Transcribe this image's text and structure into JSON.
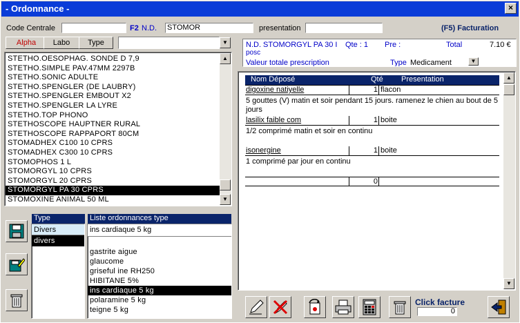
{
  "window": {
    "title": "- Ordonnance -",
    "close": "×"
  },
  "header": {
    "code_centrale_label": "Code Centrale",
    "code_centrale_value": "",
    "f2_label": "F2",
    "nd_label": "N.D.",
    "nd_value": "STOMOR",
    "presentation_label": "presentation",
    "presentation_value": "",
    "facturation_label": "(F5) Facturation"
  },
  "tabs": {
    "alpha": "Alpha",
    "labo": "Labo",
    "type": "Type"
  },
  "product_list": [
    "STETHO.OESOPHAG. SONDE D 7,9",
    "STETHO.SIMPLE PAV.47MM 2297B",
    "STETHO.SONIC ADULTE",
    "STETHO.SPENGLER (DE LAUBRY)",
    "STETHO.SPENGLER EMBOUT X2",
    "STETHO.SPENGLER LA LYRE",
    "STETHO.TOP PHONO",
    "STETHOSCOPE HAUPTNER RURAL",
    "STETHOSCOPE RAPPAPORT 80CM",
    "STOMADHEX C100 10 CPRS",
    "STOMADHEX C300 10 CPRS",
    "STOMOPHOS 1 L",
    "STOMORGYL 10 CPRS",
    "STOMORGYL 20 CPRS",
    "STOMORGYL PA 30 CPRS",
    "STOMOXINE ANIMAL 50 ML"
  ],
  "selected_product_index": 14,
  "info": {
    "nd_text": "N.D. STOMORGYL PA 30 I",
    "posc": "posc",
    "qte_label": "Qte : 1",
    "pre_label": "Pre :",
    "total_label": "Total",
    "total_value": "7.10 €",
    "valeur_label": "Valeur totale prescription",
    "type_label": "Type",
    "type_value": "Medicament"
  },
  "prescription": {
    "headers": {
      "nom": "Nom Déposé",
      "qte": "Qté",
      "presentation": "Presentation"
    },
    "rows": [
      {
        "nom": "digoxine natiyelle",
        "qte": "1",
        "presentation": "flacon",
        "posologie": "5 gouttes (V) matin et soir pendant 15 jours. ramenez le chien au bout de 5 jours"
      },
      {
        "nom": "lasilix faible com",
        "qte": "1",
        "presentation": "boite",
        "posologie": "1/2 comprimé matin et soir en continu"
      },
      {
        "nom": "isonergine",
        "qte": "1",
        "presentation": "boite",
        "posologie": "1 comprimé par jour en continu"
      },
      {
        "nom": "",
        "qte": "0",
        "presentation": "",
        "posologie": ""
      }
    ]
  },
  "type_list": {
    "header": "Type",
    "items": [
      "Divers",
      "divers"
    ],
    "selected_index": 1
  },
  "ordonnances_list": {
    "header": "Liste ordonnances type",
    "current": "ins cardiaque 5 kg",
    "items": [
      "gastrite aigue",
      "glaucome",
      "griseful ine RH250",
      "HIBITANE 5%",
      "ins cardiaque 5 kg",
      "polaramine 5 kg",
      "teigne 5 kg"
    ],
    "selected_index": 4
  },
  "click_facture": {
    "label": "Click facture",
    "value": "0"
  }
}
